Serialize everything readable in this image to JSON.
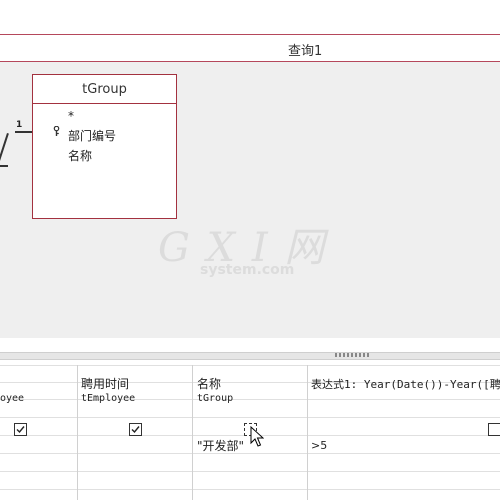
{
  "window": {
    "title": "查询1"
  },
  "table": {
    "name": "tGroup",
    "fields": [
      "*",
      "部门编号",
      "名称"
    ]
  },
  "relationship": {
    "one_label": "1"
  },
  "grid": {
    "columns": [
      {
        "field": "",
        "table": "oyee",
        "show": true,
        "criteria": ""
      },
      {
        "field": "聘用时间",
        "table": "tEmployee",
        "show": true,
        "criteria": ""
      },
      {
        "field": "名称",
        "table": "tGroup",
        "show": false,
        "criteria": "\"开发部\""
      },
      {
        "field": "表达式1: Year(Date())-Year([聘用",
        "table": "",
        "show": false,
        "criteria": ">5"
      }
    ]
  },
  "watermark": {
    "main": "G X I 网",
    "sub": "system.com"
  }
}
